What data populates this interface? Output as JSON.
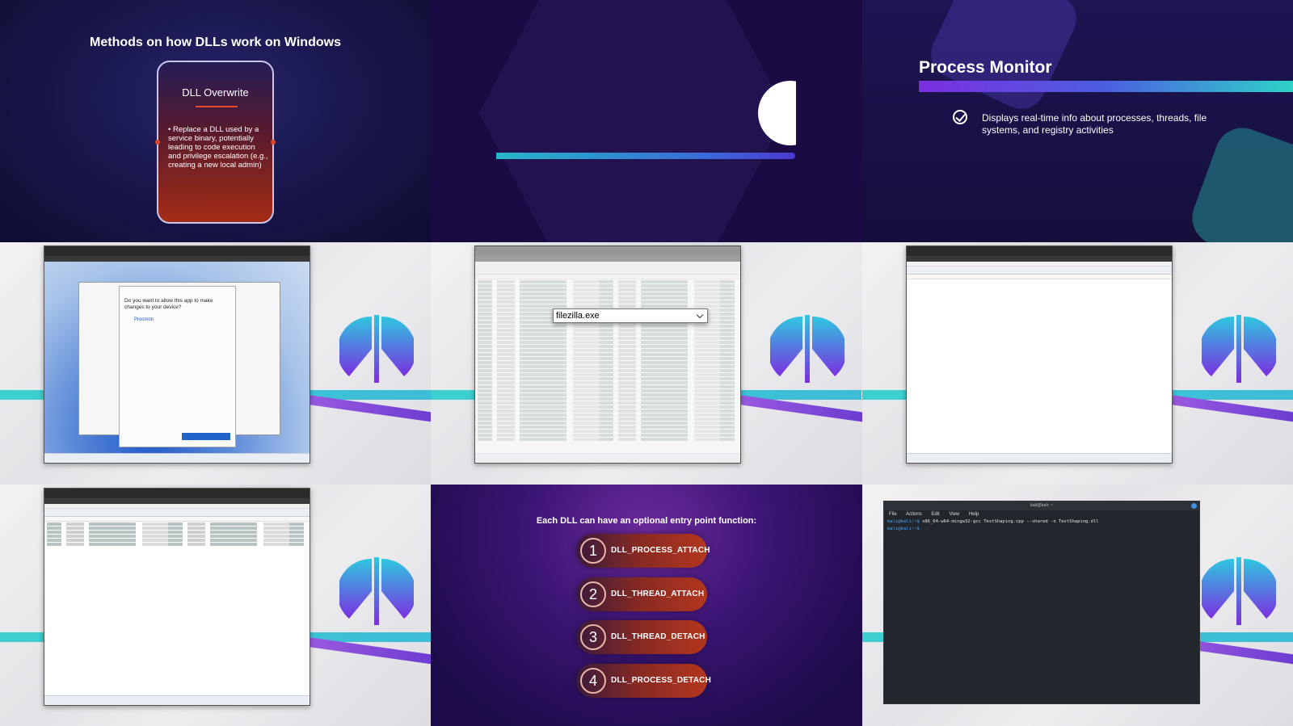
{
  "tile1": {
    "title": "Methods on how DLLs work on Windows",
    "card_title": "DLL Overwrite",
    "card_text": "Replace a DLL used by a service binary, potentially leading to code execution and privilege escalation (e.g., creating a new local admin)"
  },
  "tile3": {
    "title": "Process Monitor",
    "description": "Displays real-time info about processes, threads, file systems, and registry activities"
  },
  "tile4": {
    "uac_question": "Do you want to allow this app to make changes to your device?",
    "app_name": "Procmon"
  },
  "tile5": {
    "dropdown_value": "filezilla.exe"
  },
  "tile8": {
    "title": "Each DLL can have an optional entry point function:",
    "items": [
      {
        "num": "1",
        "label": "DLL_PROCESS_ATTACH"
      },
      {
        "num": "2",
        "label": "DLL_THREAD_ATTACH"
      },
      {
        "num": "3",
        "label": "DLL_THREAD_DETACH"
      },
      {
        "num": "4",
        "label": "DLL_PROCESS_DETACH"
      }
    ]
  },
  "tile9": {
    "window_title": "kali@kali: ~",
    "menu": [
      "File",
      "Actions",
      "Edit",
      "View",
      "Help"
    ],
    "prompt": "kali@kali:~$",
    "command": "x86_64-w64-mingw32-gcc TextShaping.cpp --shared -o TextShaping.dll"
  },
  "colors": {
    "accent_cyan": "#2ed3c8",
    "accent_purple": "#7a2fe0",
    "accent_orange": "#b2361e"
  }
}
